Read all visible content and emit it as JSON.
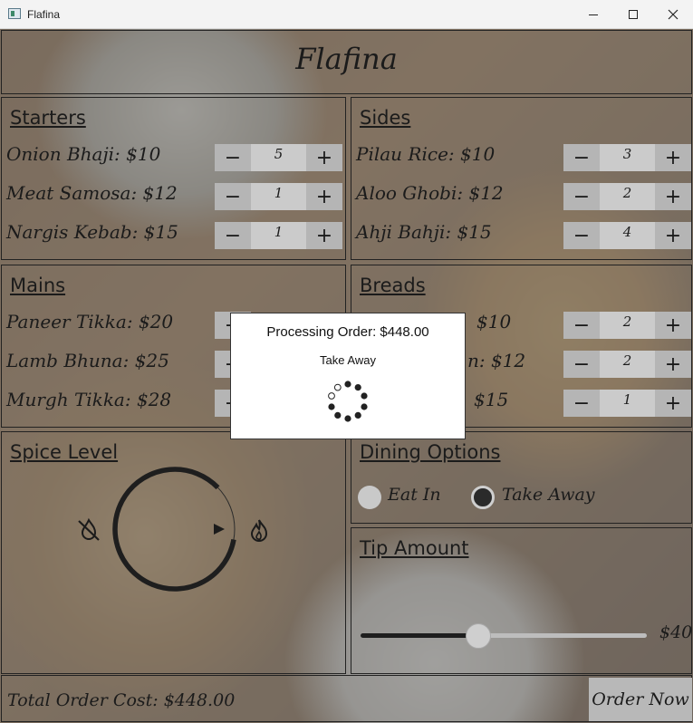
{
  "window": {
    "title": "Flafina",
    "icon": "app-window-icon"
  },
  "app": {
    "heading": "Flafina"
  },
  "starters": {
    "title": "Starters",
    "items": [
      {
        "label": "Onion Bhaji: $10",
        "qty": "5"
      },
      {
        "label": "Meat Samosa: $12",
        "qty": "1"
      },
      {
        "label": "Nargis Kebab: $15",
        "qty": "1"
      }
    ]
  },
  "sides": {
    "title": "Sides",
    "items": [
      {
        "label": "Pilau Rice: $10",
        "qty": "3"
      },
      {
        "label": "Aloo Ghobi: $12",
        "qty": "2"
      },
      {
        "label": "Ahji Bahji: $15",
        "qty": "4"
      }
    ]
  },
  "mains": {
    "title": "Mains",
    "items": [
      {
        "label": "Paneer Tikka: $20"
      },
      {
        "label": "Lamb Bhuna: $25"
      },
      {
        "label": "Murgh Tikka: $28"
      }
    ]
  },
  "breads": {
    "title": "Breads",
    "items": [
      {
        "label": "$10",
        "qty": "2"
      },
      {
        "label": "n: $12",
        "qty": "2"
      },
      {
        "label": "$15",
        "qty": "1"
      }
    ]
  },
  "stepper": {
    "minus": "−",
    "plus": "+"
  },
  "spice": {
    "title": "Spice Level",
    "icons": [
      "no-spice-icon",
      "flame-icon"
    ],
    "level_fraction": 0.85
  },
  "dining": {
    "title": "Dining Options",
    "options": [
      "Eat In",
      "Take Away"
    ],
    "selected": "Take Away"
  },
  "tip": {
    "title": "Tip Amount",
    "value": "$40",
    "slider_fraction": 0.41
  },
  "footer": {
    "total": "Total Order Cost: $448.00",
    "order_button": "Order Now"
  },
  "modal": {
    "title": "Processing Order: $448.00",
    "subtitle": "Take Away"
  },
  "colors": {
    "overlay": "#6e6e6e",
    "stepper_button": "#b5b5b5",
    "dialog_bg": "#ffffff"
  }
}
